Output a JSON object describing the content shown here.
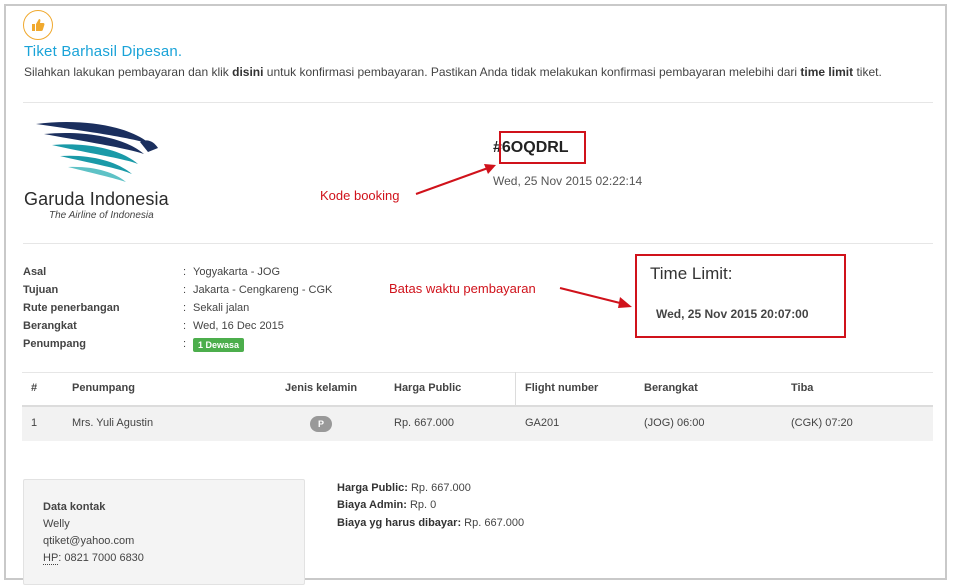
{
  "success": {
    "icon": "thumbs-up-icon",
    "title": "Tiket Barhasil Dipesan.",
    "message_part1": "Silahkan lakukan pembayaran dan klik ",
    "message_link": "disini",
    "message_part2": " untuk konfirmasi pembayaran. Pastikan Anda tidak melakukan konfirmasi pembayaran melebihi dari ",
    "message_bold": "time limit",
    "message_part3": " tiket."
  },
  "airline": {
    "name": "Garuda Indonesia",
    "tagline": "The Airline of Indonesia"
  },
  "booking": {
    "code": "#6OQDRL",
    "datetime": "Wed, 25 Nov 2015 02:22:14"
  },
  "annotations": {
    "booking_code_label": "Kode booking",
    "time_limit_label": "Batas waktu pembayaran"
  },
  "time_limit": {
    "title": "Time Limit:",
    "value": "Wed, 25 Nov 2015 20:07:00"
  },
  "trip": {
    "rows": [
      {
        "label": "Asal",
        "value": "Yogyakarta - JOG"
      },
      {
        "label": "Tujuan",
        "value": "Jakarta - Cengkareng - CGK"
      },
      {
        "label": "Rute penerbangan",
        "value": "Sekali jalan"
      },
      {
        "label": "Berangkat",
        "value": "Wed, 16 Dec 2015"
      },
      {
        "label": "Penumpang",
        "value": "1 Dewasa"
      }
    ],
    "colon": ":"
  },
  "table": {
    "headers": [
      "#",
      "Penumpang",
      "Jenis kelamin",
      "Harga Public",
      "Flight number",
      "Berangkat",
      "Tiba"
    ],
    "rows": [
      [
        "1",
        "Mrs. Yuli Agustin",
        "P",
        "Rp. 667.000",
        "GA201",
        "(JOG) 06:00",
        "(CGK) 07:20"
      ]
    ]
  },
  "contact": {
    "title": "Data kontak",
    "name": "Welly",
    "email": "qtiket@yahoo.com",
    "phone_label": "HP",
    "phone": ": 0821 7000 6830"
  },
  "pricing": {
    "public_label": "Harga Public:",
    "public_value": " Rp. 667.000",
    "admin_label": "Biaya Admin:",
    "admin_value": " Rp. 0",
    "total_label": "Biaya yg harus dibayar:",
    "total_value": " Rp. 667.000"
  },
  "colors": {
    "accent": "#1aa3d8",
    "annotation_red": "#d0121b",
    "badge_green": "#4cae4c",
    "garuda_navy": "#1b2f5e",
    "garuda_teal": "#1a9aa8"
  }
}
